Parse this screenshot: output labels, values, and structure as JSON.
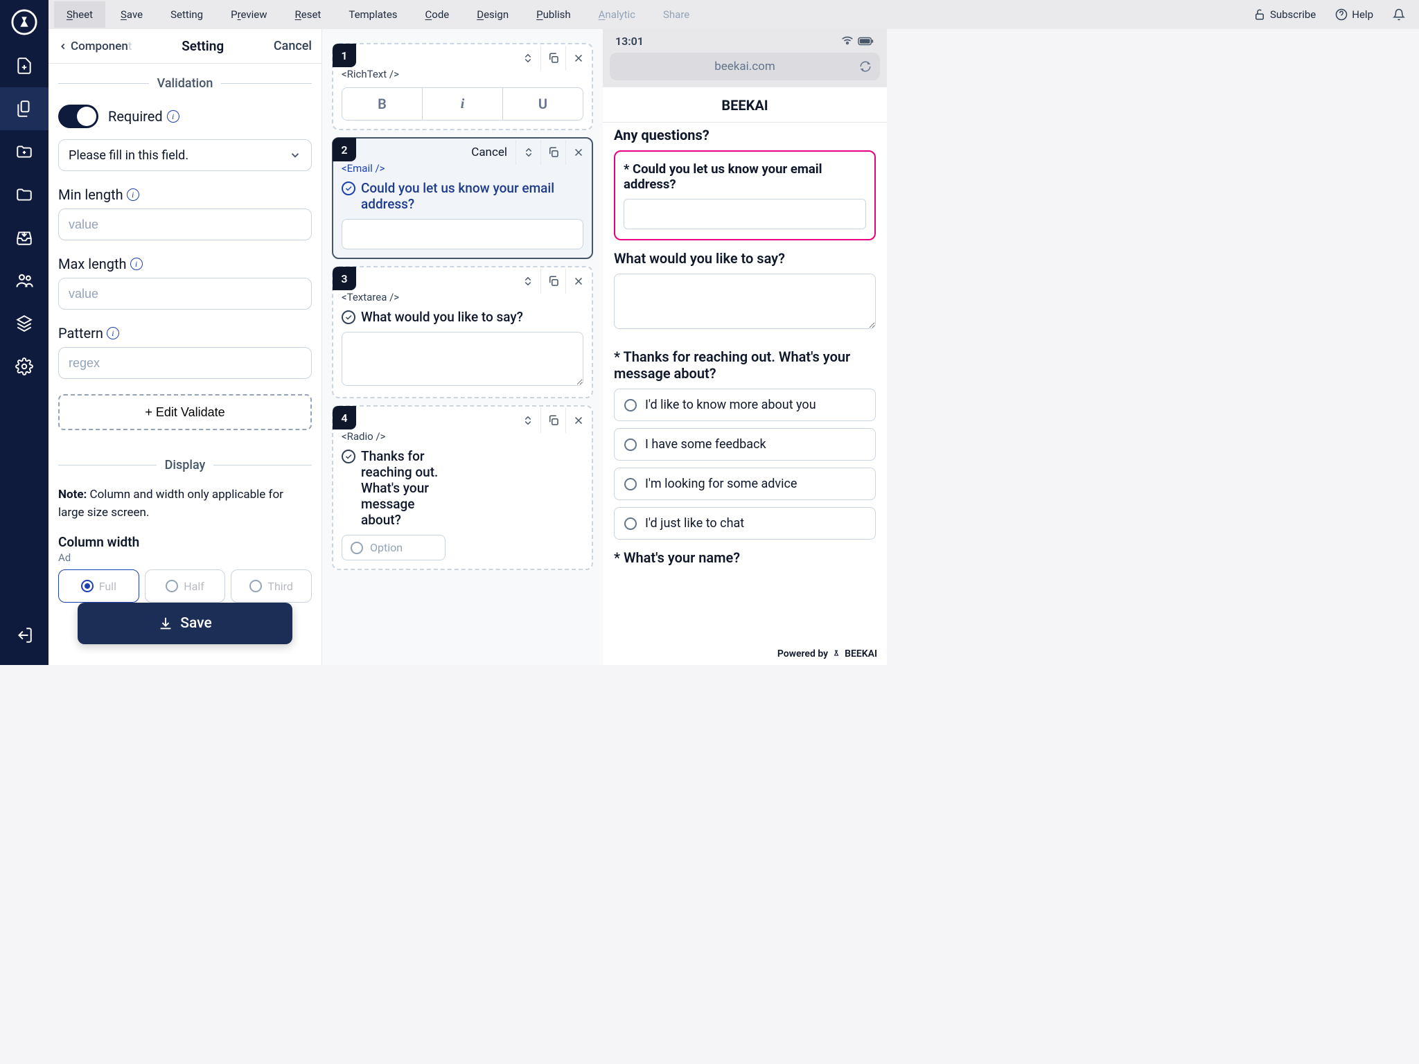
{
  "topbar": {
    "menu": [
      "Sheet",
      "Save",
      "Setting",
      "Preview",
      "Reset",
      "Templates",
      "Code",
      "Design",
      "Publish",
      "Analytic",
      "Share"
    ],
    "subscribe": "Subscribe",
    "help": "Help"
  },
  "settings": {
    "back": "Componen",
    "back_faded": "t",
    "title": "Setting",
    "cancel": "Cancel",
    "validation_label": "Validation",
    "required": "Required",
    "dropdown_value": "Please fill in this field.",
    "min_length": "Min length",
    "max_length": "Max length",
    "pattern": "Pattern",
    "value_ph": "value",
    "regex_ph": "regex",
    "edit_validate": "+ Edit Validate",
    "display_label": "Display",
    "note_bold": "Note:",
    "note_text": " Column and width only applicable for large size screen.",
    "column_width": "Column width",
    "column_hint": "Ad",
    "radio_options": [
      "Full",
      "Half",
      "Third"
    ],
    "save": "Save"
  },
  "canvas": {
    "cancel": "Cancel",
    "cards": [
      {
        "num": "1",
        "tag": "<RichText />"
      },
      {
        "num": "2",
        "tag": "<Email />",
        "text": "Could you let us know your email address?"
      },
      {
        "num": "3",
        "tag": "<Textarea />",
        "text": "What would you like to say?"
      },
      {
        "num": "4",
        "tag": "<Radio />",
        "text": "Thanks for reaching out. What's your message about?",
        "option": "Option"
      }
    ],
    "bold": "B",
    "italic": "i",
    "underline": "U"
  },
  "preview": {
    "time": "13:01",
    "url": "beekai.com",
    "brand": "BEEKAI",
    "any_q": "Any questions?",
    "email_q": "* Could you let us know your email address?",
    "say_q": "What would you like to say?",
    "about_q": "* Thanks for reaching out. What's your message about?",
    "options": [
      "I'd like to know more about you",
      "I have some feedback",
      "I'm looking for some advice",
      "I'd just like to chat"
    ],
    "name_q": "* What's your name?",
    "powered": "Powered by",
    "powered_brand": "BEEKAI"
  }
}
